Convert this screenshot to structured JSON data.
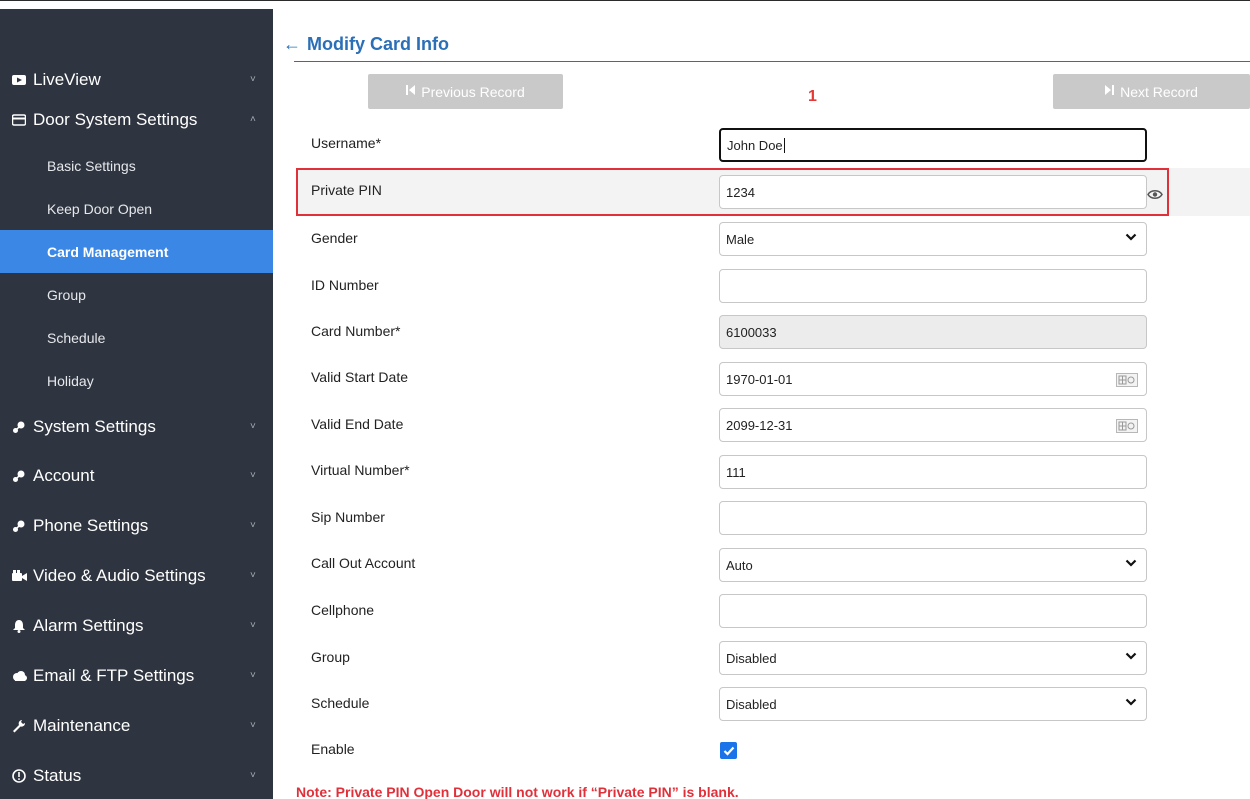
{
  "sidebar": {
    "items": [
      {
        "label": "LiveView",
        "icon": "tv-icon",
        "chev": "˅"
      },
      {
        "label": "Door System Settings",
        "icon": "door-icon",
        "chev": "˄"
      },
      {
        "label": "System Settings",
        "icon": "tools-icon",
        "chev": "˅"
      },
      {
        "label": "Account",
        "icon": "tools-icon",
        "chev": "˅"
      },
      {
        "label": "Phone Settings",
        "icon": "tools-icon",
        "chev": "˅"
      },
      {
        "label": "Video & Audio Settings",
        "icon": "video-icon",
        "chev": "˅"
      },
      {
        "label": "Alarm Settings",
        "icon": "bell-icon",
        "chev": "˅"
      },
      {
        "label": "Email & FTP Settings",
        "icon": "cloud-icon",
        "chev": "˅"
      },
      {
        "label": "Maintenance",
        "icon": "wrench-icon",
        "chev": "˅"
      },
      {
        "label": "Status",
        "icon": "info-icon",
        "chev": "˅"
      }
    ],
    "subitems": [
      {
        "label": "Basic Settings"
      },
      {
        "label": "Keep Door Open"
      },
      {
        "label": "Card Management",
        "active": true
      },
      {
        "label": "Group"
      },
      {
        "label": "Schedule"
      },
      {
        "label": "Holiday"
      }
    ]
  },
  "header": {
    "back": "←",
    "title": "Modify Card Info"
  },
  "records": {
    "prev_label": "Previous Record",
    "next_label": "Next Record",
    "index": "1"
  },
  "form": {
    "username": {
      "label": "Username*",
      "value": "John Doe"
    },
    "private_pin": {
      "label": "Private PIN",
      "value": "1234"
    },
    "gender": {
      "label": "Gender",
      "value": "Male"
    },
    "id_number": {
      "label": "ID Number",
      "value": ""
    },
    "card_number": {
      "label": "Card Number*",
      "value": "6100033"
    },
    "valid_start": {
      "label": "Valid Start Date",
      "value": "1970-01-01"
    },
    "valid_end": {
      "label": "Valid End Date",
      "value": "2099-12-31"
    },
    "virtual_number": {
      "label": "Virtual Number*",
      "value": "111"
    },
    "sip_number": {
      "label": "Sip Number",
      "value": ""
    },
    "call_out": {
      "label": "Call Out Account",
      "value": "Auto"
    },
    "cellphone": {
      "label": "Cellphone",
      "value": ""
    },
    "group": {
      "label": "Group",
      "value": "Disabled"
    },
    "schedule": {
      "label": "Schedule",
      "value": "Disabled"
    },
    "enable": {
      "label": "Enable",
      "checked": true
    }
  },
  "note": "Note: Private PIN Open Door will not work if “Private PIN” is blank.",
  "colors": {
    "sidebar_bg": "#2f3540",
    "active_item": "#3b87e6",
    "title_blue": "#2a6fb7",
    "alert_red": "#e0313b",
    "checkbox_blue": "#1a73e8"
  }
}
